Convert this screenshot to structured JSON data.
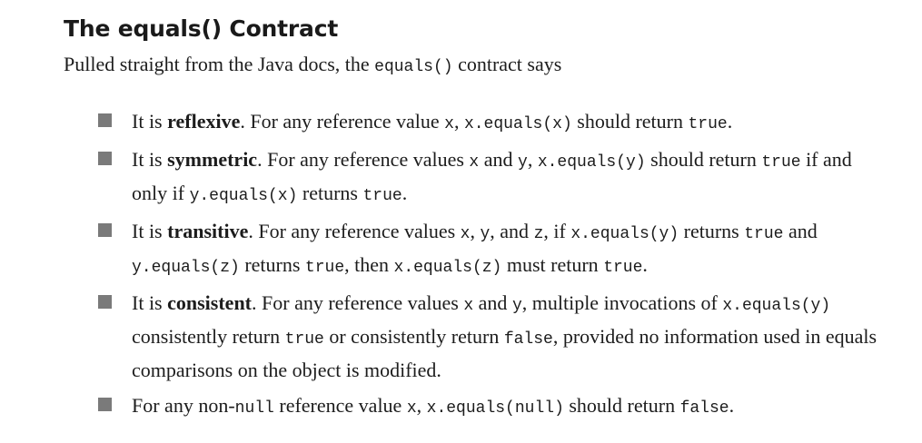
{
  "heading": "The equals() Contract",
  "intro": {
    "text": "Pulled straight from the Java docs, the ",
    "code": "equals()",
    "tail": " contract says"
  },
  "rules": [
    {
      "segments": [
        {
          "t": "text",
          "v": "It is "
        },
        {
          "t": "bold",
          "v": "reflexive"
        },
        {
          "t": "text",
          "v": ". For any reference value "
        },
        {
          "t": "code",
          "v": "x"
        },
        {
          "t": "text",
          "v": ", "
        },
        {
          "t": "code",
          "v": "x.equals(x)"
        },
        {
          "t": "text",
          "v": " should return "
        },
        {
          "t": "code",
          "v": "true"
        },
        {
          "t": "text",
          "v": "."
        }
      ]
    },
    {
      "segments": [
        {
          "t": "text",
          "v": "It is "
        },
        {
          "t": "bold",
          "v": "symmetric"
        },
        {
          "t": "text",
          "v": ". For any reference values "
        },
        {
          "t": "code",
          "v": "x"
        },
        {
          "t": "text",
          "v": " and "
        },
        {
          "t": "code",
          "v": "y"
        },
        {
          "t": "text",
          "v": ", "
        },
        {
          "t": "code",
          "v": "x.equals(y)"
        },
        {
          "t": "text",
          "v": " should return "
        },
        {
          "t": "code",
          "v": "true"
        },
        {
          "t": "text",
          "v": " if and only if "
        },
        {
          "t": "code",
          "v": "y.equals(x)"
        },
        {
          "t": "text",
          "v": " returns "
        },
        {
          "t": "code",
          "v": "true"
        },
        {
          "t": "text",
          "v": "."
        }
      ]
    },
    {
      "segments": [
        {
          "t": "text",
          "v": "It is "
        },
        {
          "t": "bold",
          "v": "transitive"
        },
        {
          "t": "text",
          "v": ". For any reference values "
        },
        {
          "t": "code",
          "v": "x"
        },
        {
          "t": "text",
          "v": ", "
        },
        {
          "t": "code",
          "v": "y"
        },
        {
          "t": "text",
          "v": ", and "
        },
        {
          "t": "code",
          "v": "z"
        },
        {
          "t": "text",
          "v": ", if "
        },
        {
          "t": "code",
          "v": "x.equals(y)"
        },
        {
          "t": "text",
          "v": " returns "
        },
        {
          "t": "code",
          "v": "true"
        },
        {
          "t": "text",
          "v": " and "
        },
        {
          "t": "code",
          "v": "y.equals(z)"
        },
        {
          "t": "text",
          "v": " returns "
        },
        {
          "t": "code",
          "v": "true"
        },
        {
          "t": "text",
          "v": ", then "
        },
        {
          "t": "code",
          "v": "x.equals(z)"
        },
        {
          "t": "text",
          "v": " must return "
        },
        {
          "t": "code",
          "v": "true"
        },
        {
          "t": "text",
          "v": "."
        }
      ]
    },
    {
      "segments": [
        {
          "t": "text",
          "v": "It is "
        },
        {
          "t": "bold",
          "v": "consistent"
        },
        {
          "t": "text",
          "v": ". For any reference values "
        },
        {
          "t": "code",
          "v": "x"
        },
        {
          "t": "text",
          "v": " and "
        },
        {
          "t": "code",
          "v": "y"
        },
        {
          "t": "text",
          "v": ", multiple invocations of "
        },
        {
          "t": "code",
          "v": "x.equals(y)"
        },
        {
          "t": "text",
          "v": " consistently return "
        },
        {
          "t": "code",
          "v": "true"
        },
        {
          "t": "text",
          "v": " or consistently return "
        },
        {
          "t": "code",
          "v": "false"
        },
        {
          "t": "text",
          "v": ", provided no information used in equals comparisons on the object is modified."
        }
      ]
    },
    {
      "segments": [
        {
          "t": "text",
          "v": "For any non-"
        },
        {
          "t": "code",
          "v": "null"
        },
        {
          "t": "text",
          "v": " reference value "
        },
        {
          "t": "code",
          "v": "x"
        },
        {
          "t": "text",
          "v": ", "
        },
        {
          "t": "code",
          "v": "x.equals(null)"
        },
        {
          "t": "text",
          "v": " should return "
        },
        {
          "t": "code",
          "v": "false"
        },
        {
          "t": "text",
          "v": "."
        }
      ]
    }
  ]
}
